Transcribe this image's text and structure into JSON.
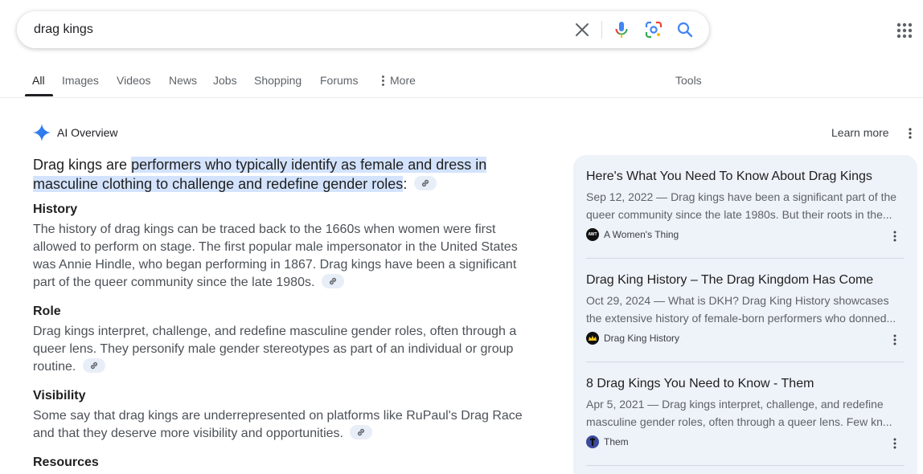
{
  "search": {
    "query": "drag kings",
    "clear_icon": "close-icon",
    "voice_icon": "mic-icon",
    "lens_icon": "camera-lens-icon",
    "search_icon": "search-icon"
  },
  "tabs": [
    {
      "label": "All",
      "active": true
    },
    {
      "label": "Images"
    },
    {
      "label": "Videos"
    },
    {
      "label": "News"
    },
    {
      "label": "Jobs"
    },
    {
      "label": "Shopping"
    },
    {
      "label": "Forums"
    },
    {
      "label": "More"
    }
  ],
  "tools_label": "Tools",
  "ai_overview": {
    "title": "AI Overview",
    "learn_more": "Learn more",
    "intro_prefix": "Drag kings are ",
    "intro_highlight": "performers who typically identify as female and dress in masculine clothing to challenge and redefine gender roles",
    "intro_suffix": ":",
    "sections": [
      {
        "title": "History",
        "body": "The history of drag kings can be traced back to the 1660s when women were first allowed to perform on stage. The first popular male impersonator in the United States was Annie Hindle, who began performing in 1867. Drag kings have been a significant part of the queer community since the late 1980s."
      },
      {
        "title": "Role",
        "body": "Drag kings interpret, challenge, and redefine masculine gender roles, often through a queer lens. They personify male gender stereotypes as part of an individual or group routine."
      },
      {
        "title": "Visibility",
        "body": "Some say that drag kings are underrepresented on platforms like RuPaul's Drag Race and that they deserve more visibility and opportunities."
      },
      {
        "title": "Resources",
        "body": ""
      }
    ]
  },
  "sources": [
    {
      "title": "Here's What You Need To Know About Drag Kings",
      "snippet_line1": "Sep 12, 2022 — Drag kings have been a significant part of the",
      "snippet_line2": "queer community since the late 1980s. But their roots in the...",
      "site": "A Women's Thing",
      "favicon_text": "AWT"
    },
    {
      "title": "Drag King History – The Drag Kingdom Has Come",
      "snippet_line1": "Oct 29, 2024 — What is DKH? Drag King History showcases",
      "snippet_line2": "the extensive history of female-born performers who donned...",
      "site": "Drag King History",
      "favicon_text": ""
    },
    {
      "title": "8 Drag Kings You Need to Know - Them",
      "snippet_line1": "Apr 5, 2021 — Drag kings interpret, challenge, and redefine",
      "snippet_line2": "masculine gender roles, often through a queer lens. Few kn...",
      "site": "Them",
      "favicon_text": ""
    }
  ],
  "colors": {
    "accent_blue": "#4285f4",
    "highlight": "#d3e3fd",
    "sources_bg": "#eef2f9"
  }
}
